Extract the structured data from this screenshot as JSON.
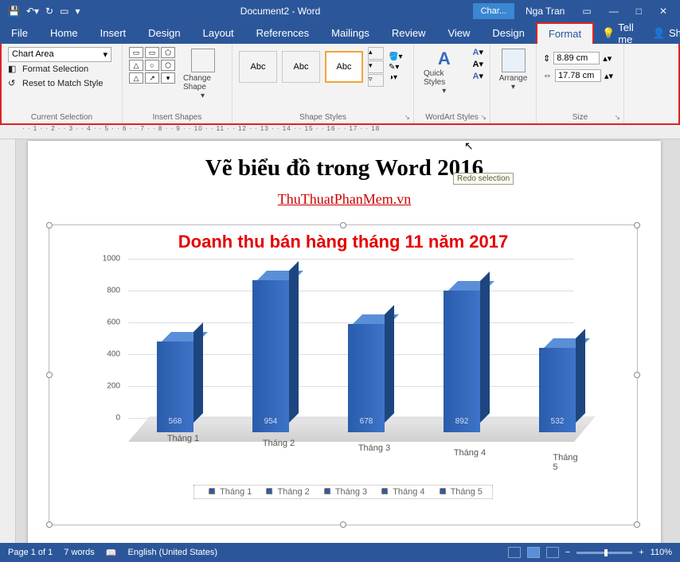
{
  "title": "Document2 - Word",
  "context_tab": "Char...",
  "user": "Nga Tran",
  "menu": {
    "file": "File",
    "home": "Home",
    "insert": "Insert",
    "design": "Design",
    "layout": "Layout",
    "references": "References",
    "mailings": "Mailings",
    "review": "Review",
    "view": "View",
    "design2": "Design",
    "format": "Format",
    "tellme": "Tell me",
    "share": "Share"
  },
  "ribbon": {
    "selector": "Chart Area",
    "format_selection": "Format Selection",
    "reset_match": "Reset to Match Style",
    "group_current": "Current Selection",
    "change_shape": "Change Shape",
    "group_shapes": "Insert Shapes",
    "abc": "Abc",
    "group_styles": "Shape Styles",
    "quick_styles": "Quick Styles",
    "group_wordart": "WordArt Styles",
    "arrange": "Arrange",
    "height": "8.89 cm",
    "width": "17.78 cm",
    "group_size": "Size"
  },
  "tooltip": "Redo selection",
  "doc": {
    "heading": "Vẽ biểu đồ trong Word 2016",
    "link": "ThuThuatPhanMem.vn",
    "chart_title": "Doanh thu bán hàng tháng 11 năm 2017"
  },
  "chart_data": {
    "type": "bar",
    "title": "Doanh thu bán hàng tháng 11 năm 2017",
    "categories": [
      "Tháng 1",
      "Tháng 2",
      "Tháng 3",
      "Tháng 4",
      "Tháng 5"
    ],
    "values": [
      568,
      954,
      678,
      892,
      532
    ],
    "ylabel": "",
    "xlabel": "",
    "ylim": [
      0,
      1000
    ],
    "yticks": [
      0,
      200,
      400,
      600,
      800,
      1000
    ],
    "legend": [
      "Tháng 1",
      "Tháng 2",
      "Tháng 3",
      "Tháng 4",
      "Tháng 5"
    ]
  },
  "status": {
    "page": "Page 1 of 1",
    "words": "7 words",
    "lang": "English (United States)",
    "zoom": "110%"
  }
}
